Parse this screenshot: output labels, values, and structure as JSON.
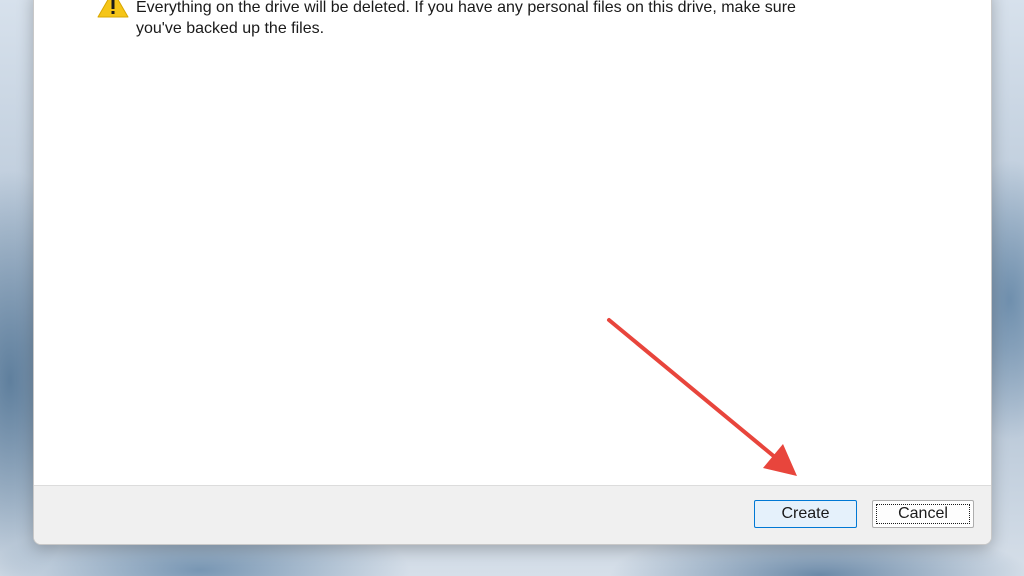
{
  "dialog": {
    "warning_text": "Everything on the drive will be deleted. If you have any personal files on this drive, make sure you've backed up the files.",
    "warning_icon": "warning-icon",
    "buttons": {
      "create_label": "Create",
      "cancel_label": "Cancel"
    }
  },
  "colors": {
    "warning_yellow": "#f5c518",
    "annotation_arrow": "#e8453c",
    "primary_button_border": "#0078d4"
  }
}
